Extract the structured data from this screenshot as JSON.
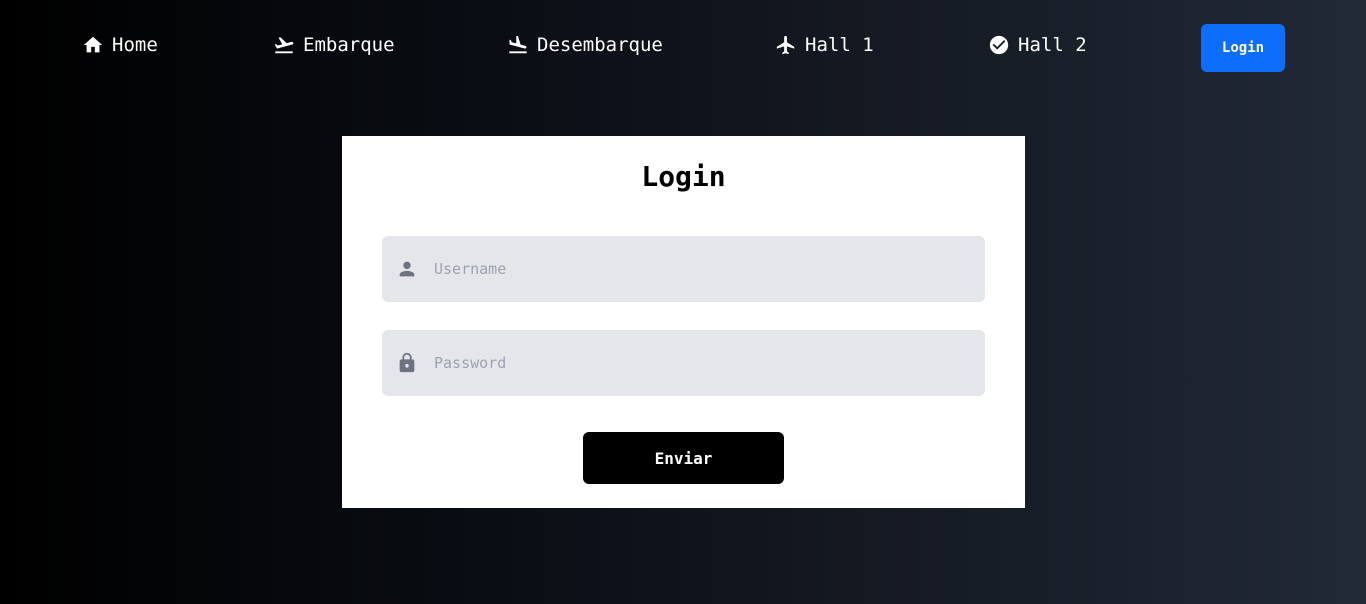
{
  "nav": {
    "items": [
      {
        "label": "Home",
        "icon": "home-icon"
      },
      {
        "label": "Embarque",
        "icon": "flight-takeoff-icon"
      },
      {
        "label": "Desembarque",
        "icon": "flight-land-icon"
      },
      {
        "label": "Hall 1",
        "icon": "airplane-icon"
      },
      {
        "label": "Hall 2",
        "icon": "check-circle-icon"
      }
    ],
    "login_label": "Login"
  },
  "form": {
    "title": "Login",
    "username_placeholder": "Username",
    "password_placeholder": "Password",
    "submit_label": "Enviar"
  },
  "colors": {
    "accent": "#0d6efd",
    "field_bg": "#e5e6ea",
    "button_dark": "#000000"
  }
}
